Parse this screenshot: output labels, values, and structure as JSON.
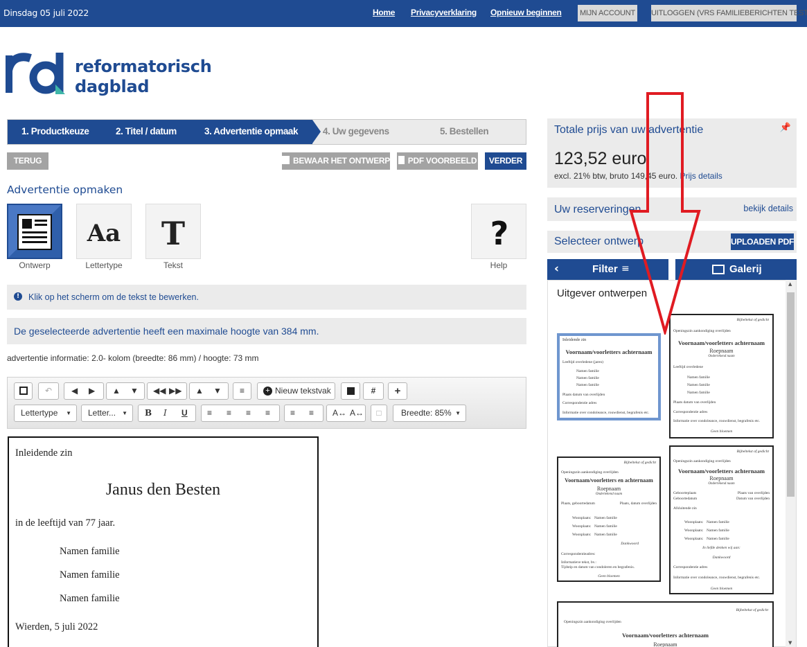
{
  "topbar": {
    "date": "Dinsdag 05 juli 2022",
    "links": [
      "Home",
      "Privacyverklaring",
      "Opnieuw beginnen"
    ],
    "account_button": "MIJN ACCOUNT",
    "logout_button": "UITLOGGEN (VRS FAMILIEBERICHTEN TEST)"
  },
  "logo": {
    "line1": "reformatorisch",
    "line2": "dagblad"
  },
  "steps": [
    "1. Productkeuze",
    "2. Titel / datum",
    "3. Advertentie opmaak",
    "4. Uw gegevens",
    "5. Bestellen"
  ],
  "actions": {
    "back": "TERUG",
    "save": "BEWAAR HET ONTWERP",
    "pdf": "PDF VOORBEELD",
    "next": "VERDER"
  },
  "section_title": "Advertentie opmaken",
  "tools": [
    "Ontwerp",
    "Lettertype",
    "Tekst",
    "Help"
  ],
  "notice": "Klik op het scherm om de tekst te bewerken.",
  "max_height_note": "De geselecteerde advertentie heeft een maximale hoogte van 384 mm.",
  "ad_info": "advertentie informatie: 2.0- kolom (breedte: 86 mm) / hoogte: 73 mm",
  "editor": {
    "new_textbox": "Nieuw tekstvak",
    "font_select": "Lettertype",
    "size_select": "Letter...",
    "width_select": "Breedte: 85%"
  },
  "ad": {
    "intro": "Inleidende zin",
    "name": "Janus den Besten",
    "age": "in de leeftijd van 77 jaar.",
    "family": [
      "Namen familie",
      "Namen familie",
      "Namen familie"
    ],
    "place_date": "Wierden, 5 juli 2022"
  },
  "sidebar": {
    "price_title": "Totale prijs van uw advertentie",
    "price": "123,52 euro",
    "price_sub": "excl. 21% btw, bruto 149,45 euro",
    "price_details": "Prijs details",
    "reservations_title": "Uw reserveringen",
    "reservations_link": "bekijk details",
    "select_title": "Selecteer ontwerp",
    "upload_pdf": "UPLOADEN PDF",
    "filter": "Filter",
    "gallery": "Galerij",
    "publisher_title": "Uitgever ontwerpen"
  },
  "thumbs": {
    "t1": {
      "l1": "Inleidende zin",
      "name": "Voornaam/voorletters achternaam",
      "l2": "Leeftijd overledene (jaren)",
      "fam": "Namen familie",
      "l3": "Plaats datum van overlijden",
      "l4": "Correspondentie adres",
      "l5": "Informatie over condoleance, rouwdienst, begrafenis etc."
    },
    "t2": {
      "top": "Bijbeltekst of gedicht",
      "l1": "Openingszin aankondiging overlijden",
      "name": "Voornaam/voorletters achternaam",
      "sub": "Roepnaam",
      "sub2": "Ondertekend naam",
      "l2": "Leeftijd overledene",
      "fam": "Namen familie",
      "l3": "Plaats datum van overlijden",
      "l4": "Correspondentie adres",
      "l5": "Informatie over condoleance, rouwdienst, begrafenis etc.",
      "end": "Geen bloemen"
    },
    "t3": {
      "top": "Bijbeltekst of gedicht",
      "l1": "Openingszin aankondiging overlijden",
      "name": "Voornaam/voorletters en achternaam",
      "sub": "Roepnaam",
      "sub2": "Ondertekend naam",
      "l2a": "Plaats, geboortedatum",
      "l2b": "Plaats, datum overlijden",
      "wp": "Woonplaats:",
      "fam": "Namen familie",
      "dank": "Dankwoord",
      "l4": "Correspondentieadres:",
      "l5": "Informatieve tekst, bv.:",
      "l6": "Tijdstip en datum van condoleren en begrafenis.",
      "end": "Geen bloemen"
    },
    "t4": {
      "top": "Bijbeltekst of gedicht",
      "l1": "Openingszin aankondiging overlijden",
      "name": "Voornaam/voorletters achternaam",
      "sub": "Roepnaam",
      "sub2": "Ondertekend naam",
      "la": "Geboorteplaats",
      "lb": "Plaats van overlijden",
      "lc": "Geboortedatum",
      "ld": "Datum van overlijden",
      "l2": "Afsluitende zin",
      "wp": "Woonplaats:",
      "fam": "Namen familie",
      "love": "In liefde denken wij aan:",
      "dank": "Dankwoord",
      "l4": "Correspondentie adres",
      "l5": "Informatie over condoleance, rouwdienst, begrafenis etc.",
      "end": "Geen bloemen"
    },
    "t5": {
      "top": "Bijbeltekst of gedicht",
      "l1": "Openingszin aankondiging overlijden",
      "name": "Voornaam/voorletters achternaam",
      "sub": "Roepnaam"
    }
  },
  "colors": {
    "brand": "#1f4b92",
    "arrow": "#e01b22",
    "logo_accent": "#3fb6a8"
  }
}
